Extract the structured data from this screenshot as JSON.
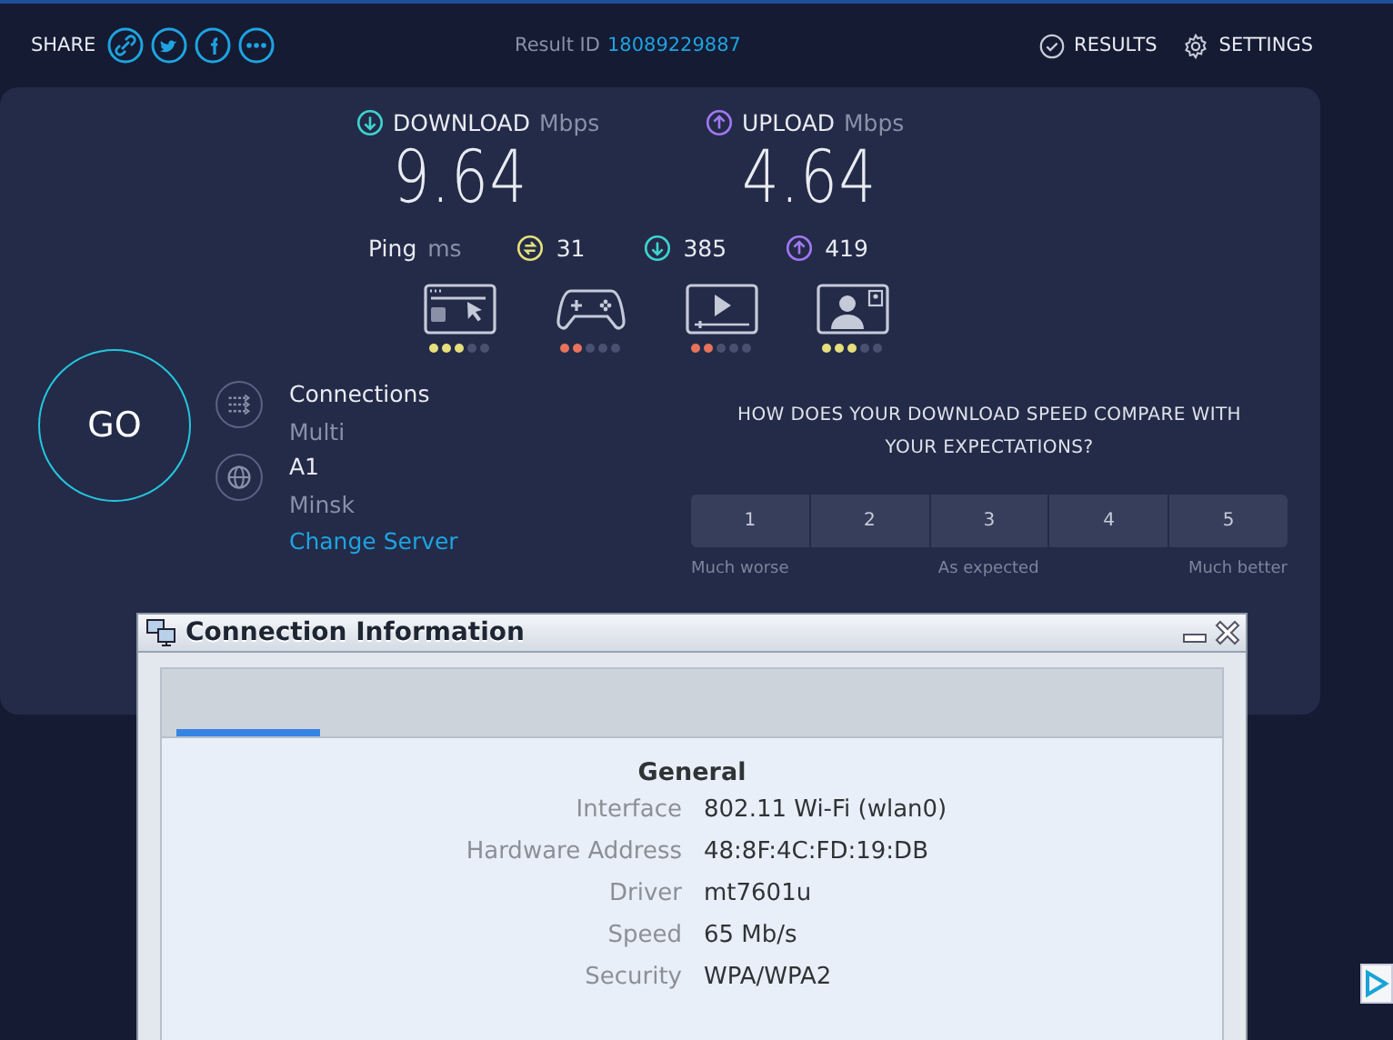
{
  "share": {
    "label": "SHARE",
    "icons": [
      {
        "kind": "link"
      },
      {
        "kind": "bird"
      },
      {
        "kind": "f"
      },
      {
        "kind": "more"
      }
    ]
  },
  "result": {
    "label": "Result ID",
    "id": "18089229887"
  },
  "nav": [
    {
      "kind": "results",
      "label": "RESULTS"
    },
    {
      "kind": "settings",
      "label": "SETTINGS"
    }
  ],
  "speeds": [
    {
      "kind": "download",
      "label": "DOWNLOAD",
      "unit": "Mbps",
      "value": "9.64"
    },
    {
      "kind": "upload",
      "label": "UPLOAD",
      "unit": "Mbps",
      "value": "4.64"
    }
  ],
  "ping": {
    "label": "Ping",
    "unit": "ms",
    "readings": [
      {
        "kind": "idle",
        "value": "31"
      },
      {
        "kind": "download",
        "value": "385"
      },
      {
        "kind": "upload",
        "value": "419"
      }
    ]
  },
  "activities": [
    {
      "kind": "browsing",
      "stars": 3,
      "color": "#e6df7b"
    },
    {
      "kind": "gaming",
      "stars": 2,
      "color": "#e8735a"
    },
    {
      "kind": "video",
      "stars": 2,
      "color": "#e8735a"
    },
    {
      "kind": "call",
      "stars": 3,
      "color": "#e6df7b"
    }
  ],
  "go": {
    "label": "GO"
  },
  "connections": {
    "label": "Connections",
    "value": "Multi"
  },
  "server": {
    "name": "A1",
    "location": "Minsk",
    "link": "Change Server"
  },
  "survey": {
    "question": "HOW DOES YOUR DOWNLOAD SPEED COMPARE WITH YOUR EXPECTATIONS?",
    "options": [
      "1",
      "2",
      "3",
      "4",
      "5"
    ],
    "scale_labels": [
      "Much worse",
      "As expected",
      "Much better"
    ]
  },
  "dialog": {
    "title": "Connection Information",
    "tabs": [
      {
        "selected": true
      }
    ],
    "section": "General",
    "rows": [
      {
        "label": "Interface",
        "value": "802.11 Wi-Fi (wlan0)"
      },
      {
        "label": "Hardware Address",
        "value": "48:8F:4C:FD:19:DB"
      },
      {
        "label": "Driver",
        "value": "mt7601u"
      },
      {
        "label": "Speed",
        "value": "65 Mb/s"
      },
      {
        "label": "Security",
        "value": "WPA/WPA2"
      }
    ]
  }
}
